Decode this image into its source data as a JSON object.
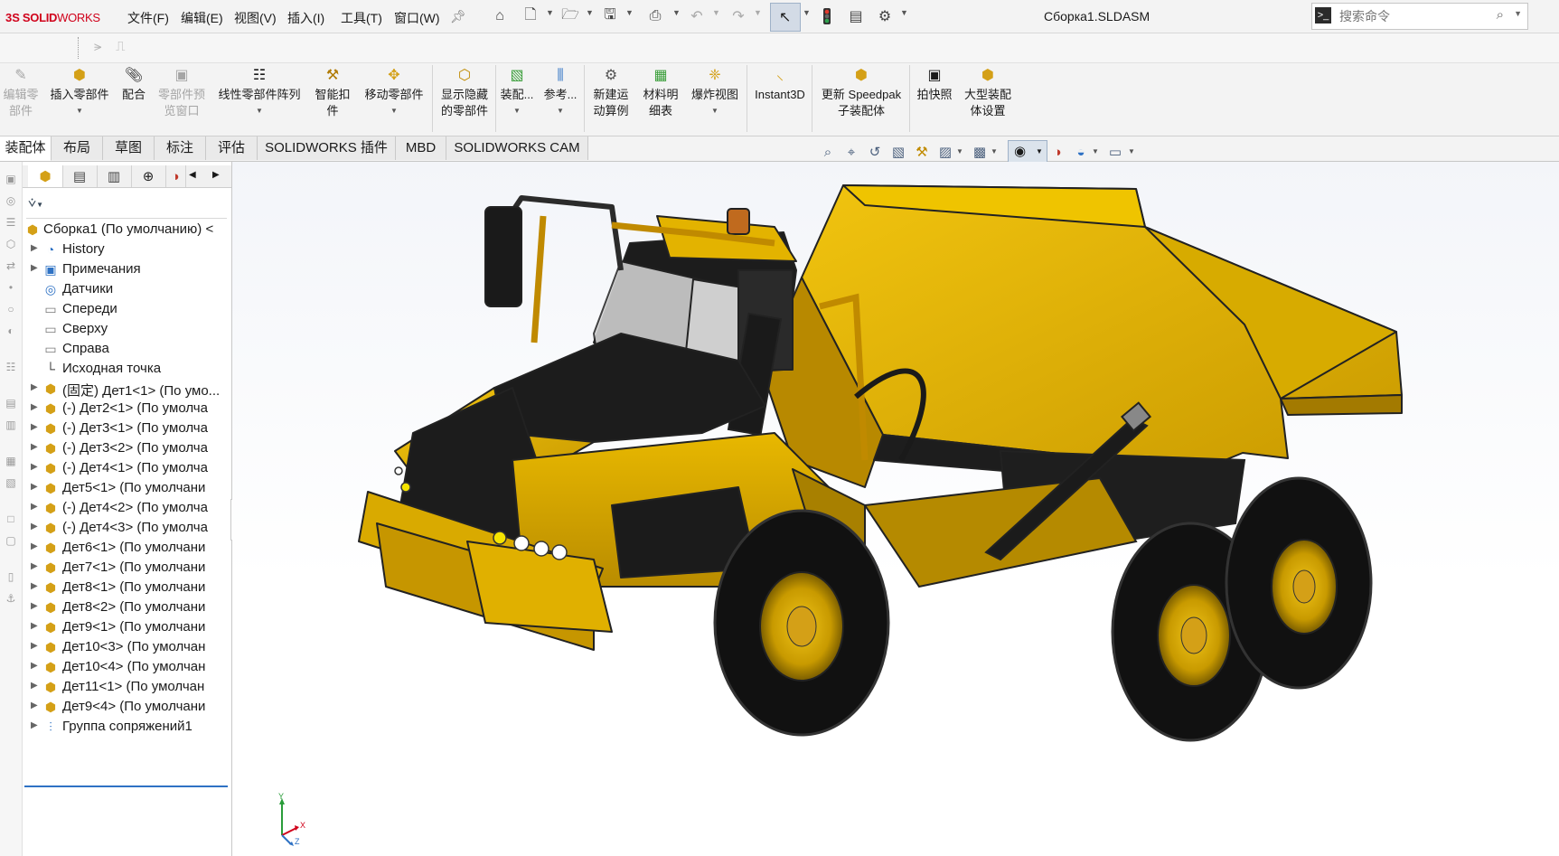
{
  "app": {
    "logo_ds": "3S",
    "logo_solid": "SOLID",
    "logo_works": "WORKS",
    "document_title": "Сборка1.SLDASM"
  },
  "menu": [
    "文件(F)",
    "编辑(E)",
    "视图(V)",
    "插入(I)",
    "工具(T)",
    "窗口(W)"
  ],
  "search": {
    "placeholder": "搜索命令",
    "value": ""
  },
  "commands": [
    {
      "label": "编辑零\n部件",
      "enabled": false
    },
    {
      "label": "插入零部件",
      "enabled": true
    },
    {
      "label": "配合",
      "enabled": true
    },
    {
      "label": "零部件预\n览窗口",
      "enabled": false
    },
    {
      "label": "线性零部件阵列",
      "enabled": true
    },
    {
      "label": "智能扣\n件",
      "enabled": true
    },
    {
      "label": "移动零部件",
      "enabled": true
    },
    {
      "label": "显示隐藏\n的零部件",
      "enabled": true
    },
    {
      "label": "装配...",
      "enabled": true
    },
    {
      "label": "参考...",
      "enabled": true
    },
    {
      "label": "新建运\n动算例",
      "enabled": true
    },
    {
      "label": "材料明\n细表",
      "enabled": true
    },
    {
      "label": "爆炸视图",
      "enabled": true
    },
    {
      "label": "Instant3D",
      "enabled": true
    },
    {
      "label": "更新 Speedpak\n子装配体",
      "enabled": true
    },
    {
      "label": "拍快照",
      "enabled": true
    },
    {
      "label": "大型装配\n体设置",
      "enabled": true
    }
  ],
  "tabs": [
    "装配体",
    "布局",
    "草图",
    "标注",
    "评估",
    "SOLIDWORKS 插件",
    "MBD",
    "SOLIDWORKS CAM"
  ],
  "active_tab": "装配体",
  "tree": {
    "root": "Сборка1  (По умолчанию) <",
    "items": [
      "History",
      "Примечания",
      "Датчики",
      "Спереди",
      "Сверху",
      "Справа",
      "Исходная точка",
      "(固定) Дет1<1> (По умо...",
      "(-) Дет2<1> (По умолча",
      "(-) Дет3<1> (По умолча",
      "(-) Дет3<2> (По умолча",
      "(-) Дет4<1> (По умолча",
      "Дет5<1> (По умолчани",
      "(-) Дет4<2> (По умолча",
      "(-) Дет4<3> (По умолча",
      "Дет6<1> (По умолчани",
      "Дет7<1> (По умолчани",
      "Дет8<1> (По умолчани",
      "Дет8<2> (По умолчани",
      "Дет9<1> (По умолчани",
      "Дет10<3> (По умолчан",
      "Дет10<4> (По умолчан",
      "Дет11<1> (По умолчан",
      "Дет9<4> (По умолчани",
      "Группа сопряжений1"
    ]
  },
  "triad": {
    "x": "X",
    "y": "Y",
    "z": "Z"
  },
  "colors": {
    "model_yellow": "#e2b400",
    "model_dark": "#1c1c1c",
    "accent_blue": "#2f72c4",
    "brand_red": "#d0021b"
  }
}
